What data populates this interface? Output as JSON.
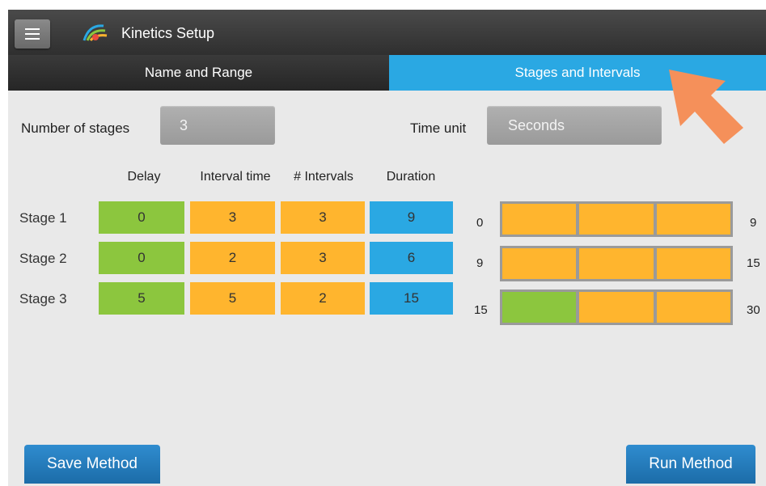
{
  "header": {
    "title": "Kinetics Setup",
    "menu_icon": "hamburger-icon",
    "logo_icon": "kinetics-logo-icon"
  },
  "tabs": [
    {
      "label": "Name and Range",
      "active": false
    },
    {
      "label": "Stages and Intervals",
      "active": true
    }
  ],
  "form": {
    "stages_label": "Number of stages",
    "stages_value": "3",
    "time_unit_label": "Time unit",
    "time_unit_value": "Seconds"
  },
  "table": {
    "columns": [
      "Delay",
      "Interval time",
      "# Intervals",
      "Duration"
    ],
    "rows": [
      {
        "label": "Stage 1",
        "delay": "0",
        "interval_time": "3",
        "intervals": "3",
        "duration": "9"
      },
      {
        "label": "Stage 2",
        "delay": "0",
        "interval_time": "2",
        "intervals": "3",
        "duration": "6"
      },
      {
        "label": "Stage 3",
        "delay": "5",
        "interval_time": "5",
        "intervals": "2",
        "duration": "15"
      }
    ]
  },
  "timeline": [
    {
      "start": "0",
      "end": "9",
      "segments": [
        "interval",
        "interval",
        "interval"
      ]
    },
    {
      "start": "9",
      "end": "15",
      "segments": [
        "interval",
        "interval",
        "interval"
      ]
    },
    {
      "start": "15",
      "end": "30",
      "segments": [
        "delay",
        "interval",
        "interval"
      ]
    }
  ],
  "buttons": {
    "save": "Save Method",
    "run": "Run Method"
  },
  "colors": {
    "delay": "#8cc63e",
    "interval": "#ffb52e",
    "duration": "#2aa8e3",
    "accent": "#2aa8e3",
    "pointer": "#f5905a"
  }
}
